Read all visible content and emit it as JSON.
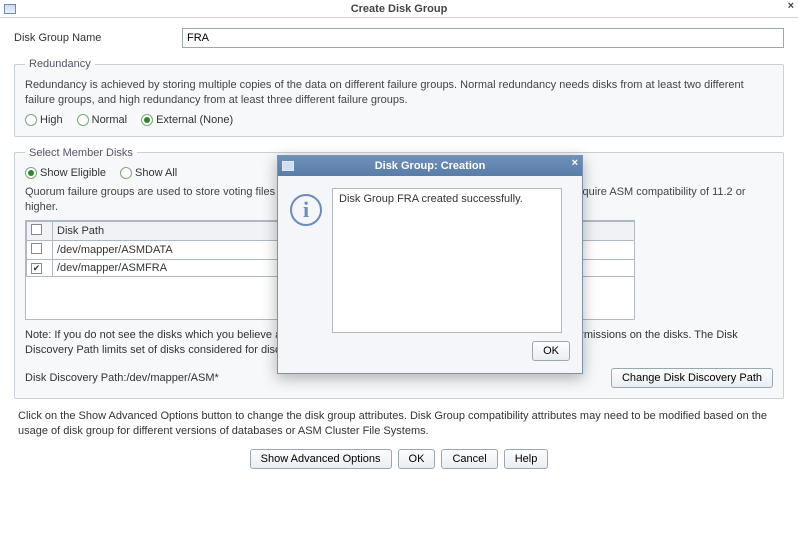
{
  "window": {
    "title": "Create Disk Group"
  },
  "diskGroupName": {
    "label": "Disk Group Name",
    "value": "FRA"
  },
  "redundancy": {
    "legend": "Redundancy",
    "desc": "Redundancy is achieved by storing multiple copies of the data on different failure groups. Normal redundancy needs disks from at least two different failure groups, and high redundancy from at least three different failure groups.",
    "options": {
      "high": "High",
      "normal": "Normal",
      "external": "External (None)"
    },
    "selected": "external"
  },
  "memberDisks": {
    "legend": "Select Member Disks",
    "showEligible": "Show Eligible",
    "showAll": "Show All",
    "showSelected": "eligible",
    "quorumDesc": "Quorum failure groups are used to store voting files in extended clusters and do not contain any user data. They require ASM compatibility of 11.2 or higher.",
    "headerDiskPath": "Disk Path",
    "rows": [
      {
        "checked": false,
        "path": "/dev/mapper/ASMDATA"
      },
      {
        "checked": true,
        "path": "/dev/mapper/ASMFRA"
      }
    ],
    "note": "Note: If you do not see the disks which you believe are available, check the Disk Discovery Path and read/write permissions on the disks. The Disk Discovery Path limits set of disks considered for discovery.",
    "discoveryLabel": "Disk Discovery Path:",
    "discoveryValue": "/dev/mapper/ASM*",
    "changePathBtn": "Change Disk Discovery Path"
  },
  "footer": {
    "desc": "Click on the Show Advanced Options button to change the disk group attributes. Disk Group compatibility attributes may need to be modified based on the usage of disk group for different versions of databases or ASM Cluster File Systems.",
    "advanced": "Show Advanced Options",
    "ok": "OK",
    "cancel": "Cancel",
    "help": "Help"
  },
  "modal": {
    "title": "Disk Group: Creation",
    "message": "Disk Group FRA created successfully.",
    "ok": "OK"
  }
}
